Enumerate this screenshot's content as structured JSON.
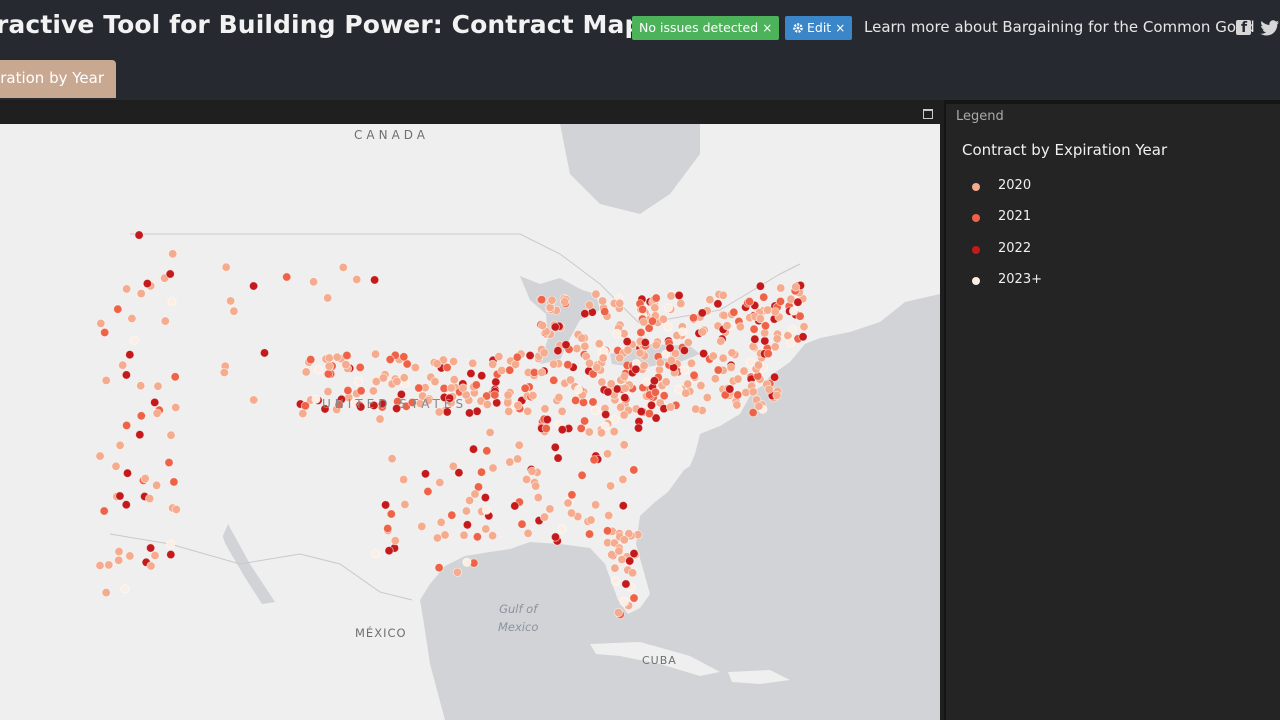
{
  "header": {
    "title": "ractive Tool for Building Power: Contract Map",
    "status_badge": "No issues detected",
    "edit_label": "Edit",
    "close_glyph": "×",
    "learn_more": "Learn more about Bargaining for the Common Good",
    "social_icons": [
      "facebook-icon",
      "twitter-icon"
    ]
  },
  "tab": {
    "label": "piration by Year"
  },
  "map": {
    "labels": {
      "canada": "CANADA",
      "usa": "UNITED STATES",
      "mexico": "MÉXICO",
      "gulf_line1": "Gulf of",
      "gulf_line2": "Mexico",
      "cuba": "CUBA"
    }
  },
  "legend": {
    "header": "Legend",
    "title": "Contract by Expiration Year",
    "items": [
      {
        "label": "2020",
        "color": "#f4ab8e"
      },
      {
        "label": "2021",
        "color": "#ee6347"
      },
      {
        "label": "2022",
        "color": "#c41a1c"
      },
      {
        "label": "2023+",
        "color": "#fdeee4"
      }
    ]
  },
  "colors": {
    "header_bg": "#262a30",
    "badge_ok": "#4db35a",
    "badge_edit": "#3b86c9",
    "tab": "#c8a891",
    "land": "#efefef",
    "water": "#d2d3d6"
  }
}
